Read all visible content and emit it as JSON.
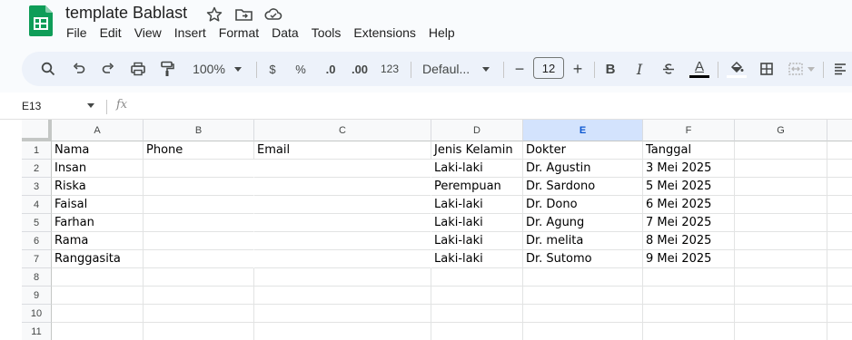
{
  "app": {
    "doc_title": "template Bablast",
    "logo_icon": "google-sheets-logo",
    "title_icons": [
      "star-icon",
      "move-to-folder-icon",
      "cloud-saved-icon"
    ],
    "brand_color": "#0f9d58"
  },
  "menu": [
    "File",
    "Edit",
    "View",
    "Insert",
    "Format",
    "Data",
    "Tools",
    "Extensions",
    "Help"
  ],
  "toolbar": {
    "zoom": "100%",
    "currency": "$",
    "percent": "%",
    "decrease_decimal": ".0",
    "increase_decimal": ".00",
    "number_format": "123",
    "font_name": "Defaul...",
    "font_size": "12",
    "minus": "−",
    "plus": "+",
    "bold": "B",
    "italic": "I",
    "text_color_letter": "A"
  },
  "formula_bar": {
    "cell_ref": "E13",
    "fx": "fx",
    "value": ""
  },
  "sheet": {
    "columns": [
      "A",
      "B",
      "C",
      "D",
      "E",
      "F",
      "G"
    ],
    "selected_column": "E",
    "row_numbers": [
      "1",
      "2",
      "3",
      "4",
      "5",
      "6",
      "7",
      "8",
      "9",
      "10",
      "11"
    ],
    "rows": [
      [
        "Nama",
        "Phone",
        "Email",
        "Jenis Kelamin",
        "Dokter",
        "Tanggal",
        ""
      ],
      [
        "Insan",
        "",
        "",
        "Laki-laki",
        "Dr. Agustin",
        "3 Mei 2025",
        ""
      ],
      [
        "Riska",
        "",
        "",
        "Perempuan",
        "Dr. Sardono",
        "5 Mei 2025",
        ""
      ],
      [
        "Faisal",
        "",
        "",
        "Laki-laki",
        "Dr. Dono",
        "6 Mei 2025",
        ""
      ],
      [
        "Farhan",
        "",
        "",
        "Laki-laki",
        "Dr. Agung",
        "7 Mei 2025",
        ""
      ],
      [
        "Rama",
        "",
        "",
        "Laki-laki",
        "Dr. melita",
        "8 Mei 2025",
        ""
      ],
      [
        "Ranggasita",
        "",
        "",
        "Laki-laki",
        "Dr. Sutomo",
        "9 Mei 2025",
        ""
      ],
      [
        "",
        "",
        "",
        "",
        "",
        "",
        ""
      ],
      [
        "",
        "",
        "",
        "",
        "",
        "",
        ""
      ],
      [
        "",
        "",
        "",
        "",
        "",
        "",
        ""
      ],
      [
        "",
        "",
        "",
        "",
        "",
        "",
        ""
      ]
    ]
  }
}
